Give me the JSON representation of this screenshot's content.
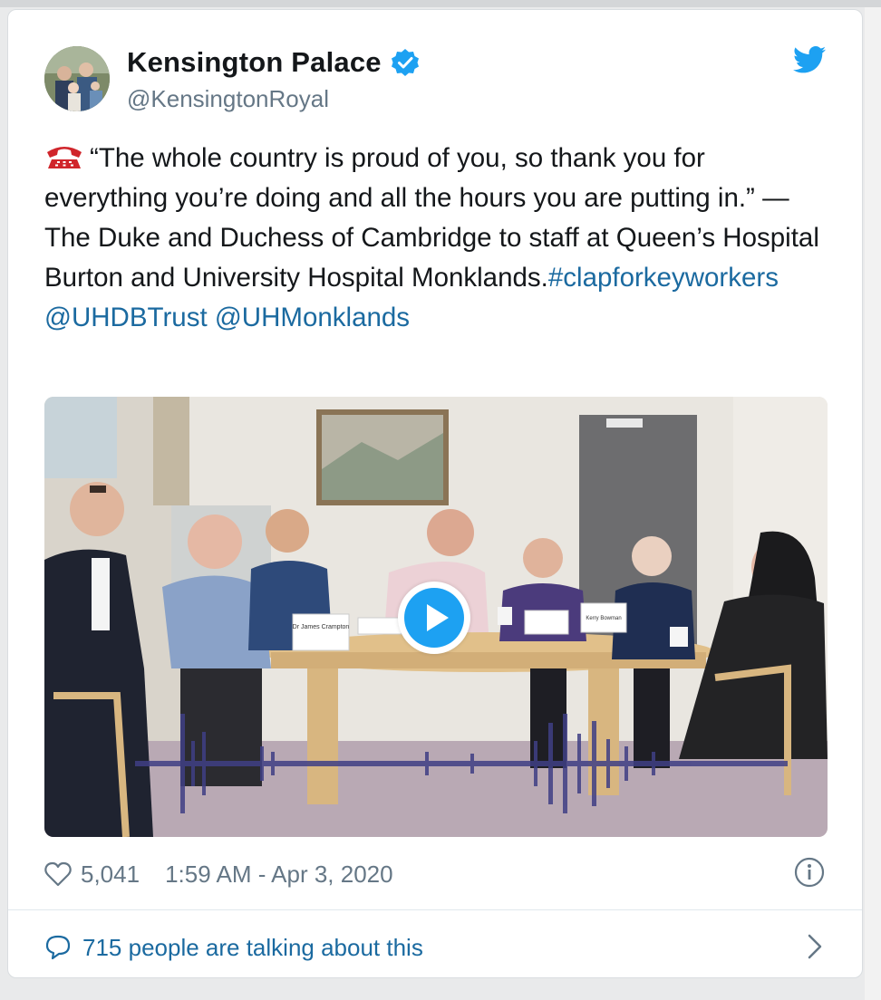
{
  "tweet": {
    "author_name": "Kensington Palace",
    "author_handle": "@KensingtonRoyal",
    "text_main": "“The whole country is proud of you, so thank you for everything you’re doing and all the hours you are putting in.” — The Duke and Duchess of Cambridge to staff at Queen’s Hospital Burton and University Hospital Monklands.",
    "hashtag": "#clapforkeyworkers",
    "mention_1": "@UHDBTrust",
    "mention_2": "@UHMonklands",
    "likes": "5,041",
    "timestamp": "1:59 AM - Apr 3, 2020",
    "talking_text": "715 people are talking about this"
  },
  "video": {
    "place_cards": [
      "Dr James Crampton",
      "Kerry Bowman"
    ]
  },
  "icons": {
    "verified": "verified-badge-icon",
    "brand": "twitter-bird-icon",
    "emoji": "telephone-icon",
    "like": "heart-icon",
    "info": "info-icon",
    "reply": "speech-bubble-icon",
    "navigate": "chevron-right-icon"
  },
  "colors": {
    "brand_blue": "#1da1f2",
    "link": "#1b6aa0",
    "secondary_text": "#657786",
    "primary_text": "#14171a"
  }
}
